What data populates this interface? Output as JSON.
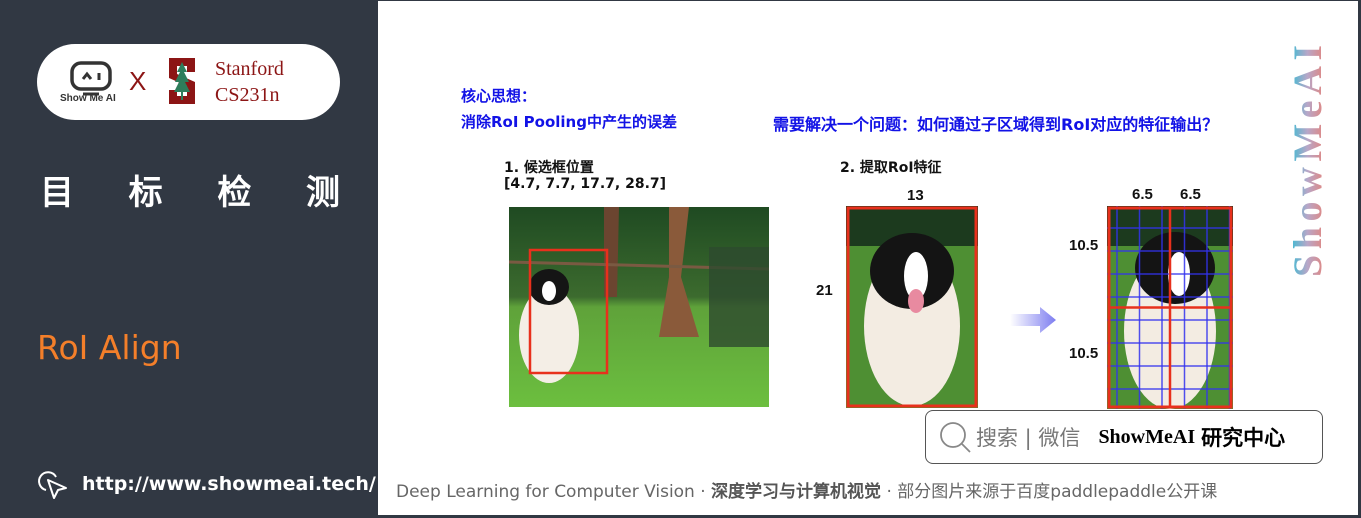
{
  "sidebar": {
    "brand_showmeai": "Show Me AI",
    "times": "X",
    "stanford_line1": "Stanford",
    "stanford_line2": "CS231n",
    "topic_chars": [
      "目",
      "标",
      "检",
      "测"
    ],
    "section_title": "RoI Align",
    "site_url": "http://www.showmeai.tech/"
  },
  "slide": {
    "core_idea_label": "核心思想：",
    "core_idea_text": "消除RoI Pooling中产生的误差",
    "question": "需要解决一个问题：如何通过子区域得到RoI对应的特征输出？",
    "step1_title": "1. 候选框位置",
    "step1_coords": "[4.7, 7.7, 17.7, 28.7]",
    "step2_title": "2. 提取RoI特征",
    "roi_width": "13",
    "roi_height": "21",
    "sub_width_left": "6.5",
    "sub_width_right": "6.5",
    "sub_height_top": "10.5",
    "sub_height_bottom": "10.5",
    "watermark": "ShowMeAI",
    "colors": {
      "accent_blue": "#1212e6",
      "box_red": "#e8301c",
      "grid_blue": "#3333ee",
      "orange": "#f47f2a"
    }
  },
  "search": {
    "hint": "搜索 | 微信",
    "brand": "ShowMeAI",
    "suffix": "研究中心"
  },
  "footer": {
    "course_en": "Deep Learning for Computer Vision",
    "sep": "·",
    "course_cn": "深度学习与计算机视觉",
    "credit": "部分图片来源于百度paddlepaddle公开课"
  }
}
